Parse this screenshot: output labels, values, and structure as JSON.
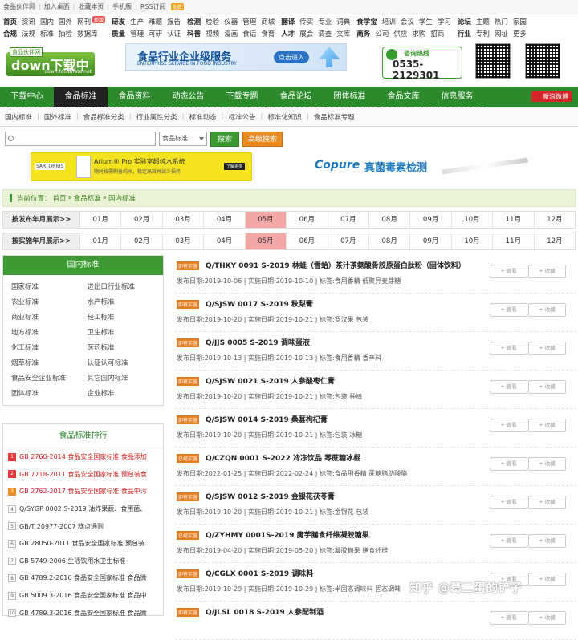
{
  "topbar": {
    "links": [
      "食品伙伴网",
      "加入桌面",
      "收藏本页",
      "手机版",
      "RSS订阅"
    ],
    "rss_badge": "免费"
  },
  "nav_columns": [
    {
      "rows": [
        [
          "首页",
          "资讯",
          "国内",
          "国外",
          "网刊"
        ],
        [
          "合规",
          "法规",
          "标准",
          "抽检",
          "数据库"
        ]
      ],
      "badge": "新版"
    },
    {
      "rows": [
        [
          "研发",
          "生产",
          "难题",
          "报告"
        ],
        [
          "质量",
          "管理",
          "可研",
          "认证"
        ]
      ]
    },
    {
      "rows": [
        [
          "检测",
          "检验",
          "仪器",
          "管理",
          "商城"
        ],
        [
          "科普",
          "视频",
          "漫画",
          "食话",
          "食育"
        ]
      ]
    },
    {
      "rows": [
        [
          "翻译",
          "传实",
          "专业",
          "词典"
        ],
        [
          "人才",
          "展会",
          "调查",
          "文库"
        ]
      ]
    },
    {
      "rows": [
        [
          "食学宝",
          "培训",
          "会议",
          "学生",
          "学习"
        ],
        [
          "商务",
          "公司",
          "供应",
          "求购",
          "招商"
        ]
      ]
    },
    {
      "rows": [
        [
          "论坛",
          "主题",
          "热门",
          "家园"
        ],
        [
          "行业",
          "专利",
          "网址",
          "更多"
        ]
      ]
    }
  ],
  "logo": {
    "small": "食品伙伴网",
    "big": "down下载中心",
    "site": "down.foodmate.net"
  },
  "ad_enterprise": {
    "title": "食品行业企业级服务",
    "subtitle": "ENTERPRISE SERVICE IN FOOD INDUSTRY",
    "button": "点击进入"
  },
  "hotline": {
    "label": "咨询热线",
    "number": "0535-2129301"
  },
  "main_nav": [
    "下载中心",
    "食品标准",
    "食品资料",
    "动态公告",
    "下载专题",
    "食品论坛",
    "团体标准",
    "食品文库",
    "信息服务"
  ],
  "main_nav_active": 1,
  "weibo": "新浪微博",
  "sub_nav": [
    "国内标准",
    "国外标准",
    "食品标准分类",
    "行业属性分类",
    "标准动态",
    "标准公告",
    "标准化知识",
    "食品标准专题"
  ],
  "search": {
    "placeholder": "",
    "select": "食品标准",
    "button": "搜索",
    "advanced": "高级搜索"
  },
  "ad_sartorius": {
    "brand": "SARTORIUS",
    "title": "Arium® Pro 实验室超纯水系统",
    "subtitle": "随时按需制备纯水，稳定高效并减少损耗",
    "more": "了解更多"
  },
  "ad_copure": {
    "brand": "Copure",
    "title": "真菌毒素检测"
  },
  "breadcrumb": {
    "label": "当前位置：",
    "items": [
      "首页",
      "食品标准",
      "国内标准"
    ]
  },
  "month_rows": [
    {
      "label": "按发布年月展示>>",
      "active": 4
    },
    {
      "label": "按实施年月展示>>",
      "active": 4
    }
  ],
  "months": [
    "01月",
    "02月",
    "03月",
    "04月",
    "05月",
    "06月",
    "07月",
    "08月",
    "09月",
    "10月",
    "11月",
    "12月"
  ],
  "left_panel": {
    "title": "国内标准",
    "categories": [
      "国家标准",
      "进出口行业标准",
      "农业标准",
      "水产标准",
      "商业标准",
      "轻工标准",
      "地方标准",
      "卫生标准",
      "化工标准",
      "医药标准",
      "烟草标准",
      "认证认可标准",
      "食品安全企业标准",
      "其它国内标准",
      "团体标准",
      "企业标准"
    ]
  },
  "ranking": {
    "title": "食品标准排行",
    "items": [
      {
        "n": "1",
        "text": "GB 2760-2014 食品安全国家标准 食品添加",
        "style": "hot"
      },
      {
        "n": "2",
        "text": "GB 7718-2011 食品安全国家标准 预包装食",
        "style": "hot"
      },
      {
        "n": "3",
        "text": "GB 2762-2017 食品安全国家标准 食品中污",
        "style": "warm"
      },
      {
        "n": "4",
        "text": "Q/SYGP 0002 S-2019 油炸果蔬、食用菌、",
        "style": "cool"
      },
      {
        "n": "5",
        "text": "GB/T 20977-2007 糕点通则",
        "style": "cool"
      },
      {
        "n": "6",
        "text": "GB 28050-2011 食品安全国家标准 预包装",
        "style": "cool"
      },
      {
        "n": "7",
        "text": "GB 5749-2006 生活饮用水卫生标准",
        "style": "cool"
      },
      {
        "n": "8",
        "text": "GB 4789.2-2016 食品安全国家标准 食品微",
        "style": "cool"
      },
      {
        "n": "9",
        "text": "GB 5009.3-2016 食品安全国家标准 食品中",
        "style": "cool"
      },
      {
        "n": "10",
        "text": "GB 4789.3-2016 食品安全国家标准 食品微",
        "style": "cool"
      }
    ]
  },
  "list_buttons": {
    "view": "+ 查看",
    "fav": "+ 收藏"
  },
  "standards": [
    {
      "tag": "即将实施",
      "title": "Q/THKY 0091 S-2019 林蛙（雪蛤）茶汁茶氨酸骨胶原蛋白肽粉（固体饮料）",
      "pub": "2019-10-06",
      "impl": "2019-10-10",
      "tags": "食用香精 低聚异麦芽糖"
    },
    {
      "tag": "即将实施",
      "title": "Q/SJSW 0017 S-2019 秋梨膏",
      "pub": "2019-10-20",
      "impl": "2019-10-21",
      "tags": "罗汉果 包装"
    },
    {
      "tag": "即将实施",
      "title": "Q/JJS 0005 S-2019 调味蛋液",
      "pub": "2019-10-13",
      "impl": "2019-10-13",
      "tags": "食用香精 香辛料"
    },
    {
      "tag": "即将实施",
      "title": "Q/SJSW 0021 S-2019 人参酸枣仁膏",
      "pub": "2019-10-20",
      "impl": "2019-10-21",
      "tags": "包装 种植"
    },
    {
      "tag": "即将实施",
      "title": "Q/SJSW 0014 S-2019 桑葚枸杞膏",
      "pub": "2019-10-20",
      "impl": "2019-10-21",
      "tags": "包装 冰糖"
    },
    {
      "tag": "已经实施",
      "title": "Q/CZQN 0001 S-2022 冷冻饮品 零蔗糖冰棍",
      "pub": "2022-01-25",
      "impl": "2022-02-24",
      "tags": "食品用香精 蔗糖脂肪酸酯"
    },
    {
      "tag": "即将实施",
      "title": "Q/SJSW 0012 S-2019 金银花茯苓膏",
      "pub": "2019-10-20",
      "impl": "2019-10-21",
      "tags": "金银花 包装"
    },
    {
      "tag": "已经实施",
      "title": "Q/ZYHMY 0001S-2019 魔芋膳食纤维凝胶糖果",
      "pub": "2019-04-20",
      "impl": "2019-05-20",
      "tags": "凝胶糖果 膳食纤维"
    },
    {
      "tag": "即将实施",
      "title": "Q/CGLX 0001 S-2019 调味料",
      "pub": "2019-10-29",
      "impl": "2019-10-29",
      "tags": "半固态调味料 固态调味"
    },
    {
      "tag": "即将实施",
      "title": "Q/JLSL 0018 S-2019 人参配制酒",
      "pub": "",
      "impl": "",
      "tags": ""
    }
  ],
  "meta_labels": {
    "pub": "发布日期:",
    "impl": "实施日期:",
    "tags": "标签:"
  },
  "watermark": "知乎 @葛二蛋的铲子"
}
